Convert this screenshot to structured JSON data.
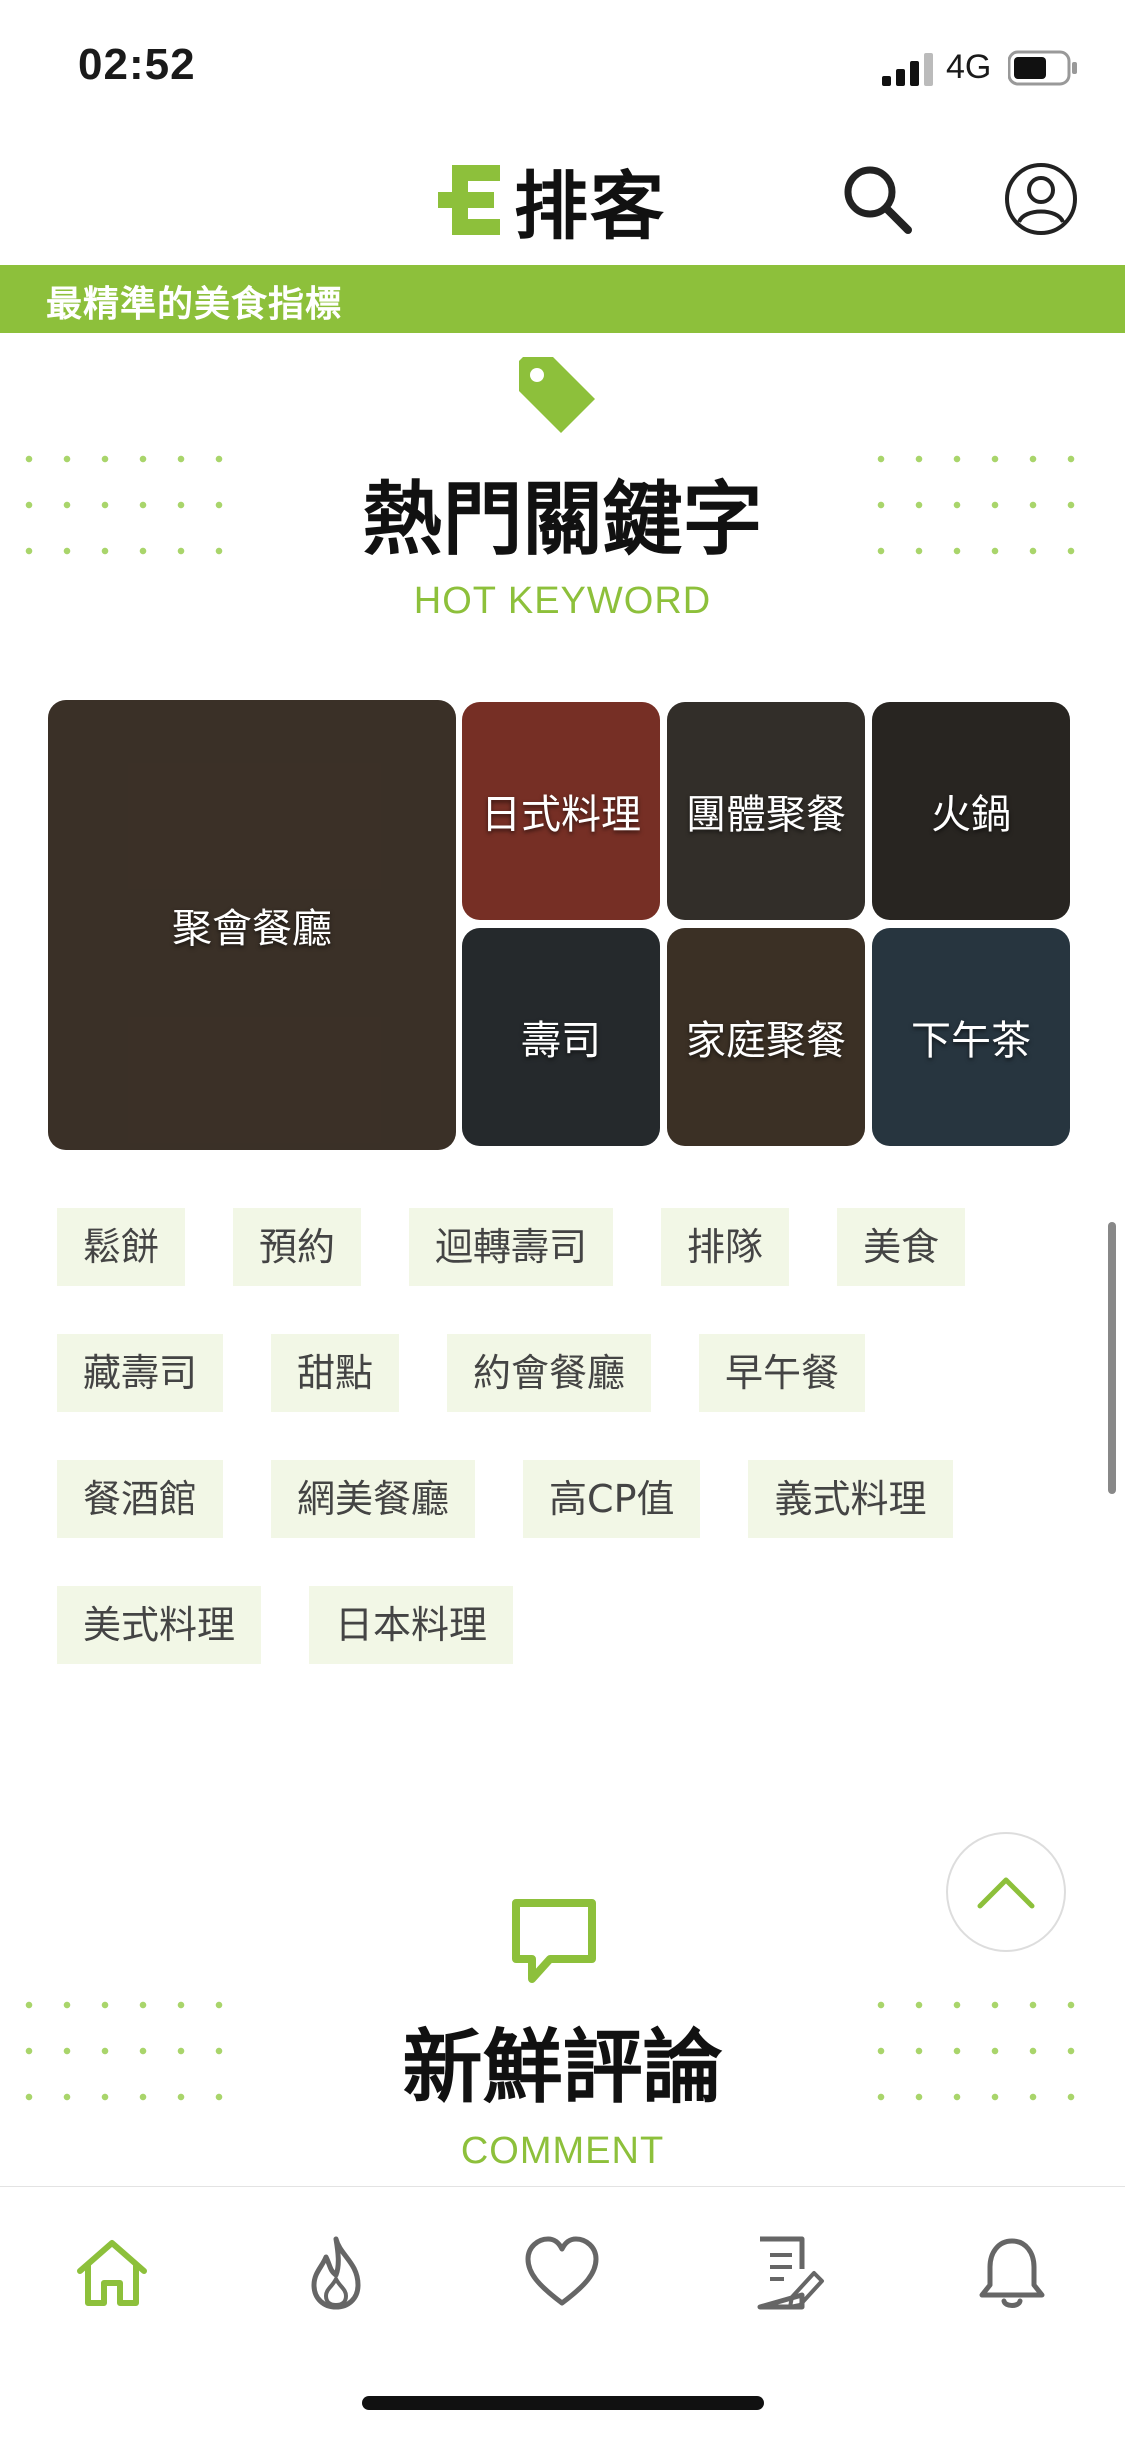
{
  "status": {
    "time": "02:52",
    "network": "4G"
  },
  "header": {
    "logo_letter": "E",
    "logo_text": "排客"
  },
  "tagline": "最精準的美食指標",
  "hot_keyword": {
    "title": "熱門關鍵字",
    "subtitle": "HOT KEYWORD",
    "tiles": [
      {
        "label": "聚會餐廳",
        "color": "#5a4a3c"
      },
      {
        "label": "日式料理",
        "color": "#b5493a"
      },
      {
        "label": "團體聚餐",
        "color": "#4e4740"
      },
      {
        "label": "火鍋",
        "color": "#3e3a33"
      },
      {
        "label": "壽司",
        "color": "#3a3f44"
      },
      {
        "label": "家庭聚餐",
        "color": "#5b4a3a"
      },
      {
        "label": "下午茶",
        "color": "#3d5262"
      }
    ],
    "tags": [
      [
        "鬆餅",
        "預約",
        "迴轉壽司",
        "排隊",
        "美食"
      ],
      [
        "藏壽司",
        "甜點",
        "約會餐廳",
        "早午餐"
      ],
      [
        "餐酒館",
        "網美餐廳",
        "高CP值",
        "義式料理"
      ],
      [
        "美式料理",
        "日本料理"
      ]
    ]
  },
  "comment": {
    "title": "新鮮評論",
    "subtitle": "COMMENT"
  },
  "tabbar": {
    "items": [
      "home-icon",
      "fire-icon",
      "heart-icon",
      "note-edit-icon",
      "bell-icon"
    ],
    "active_color": "#8dc03b",
    "inactive_color": "#666666"
  }
}
